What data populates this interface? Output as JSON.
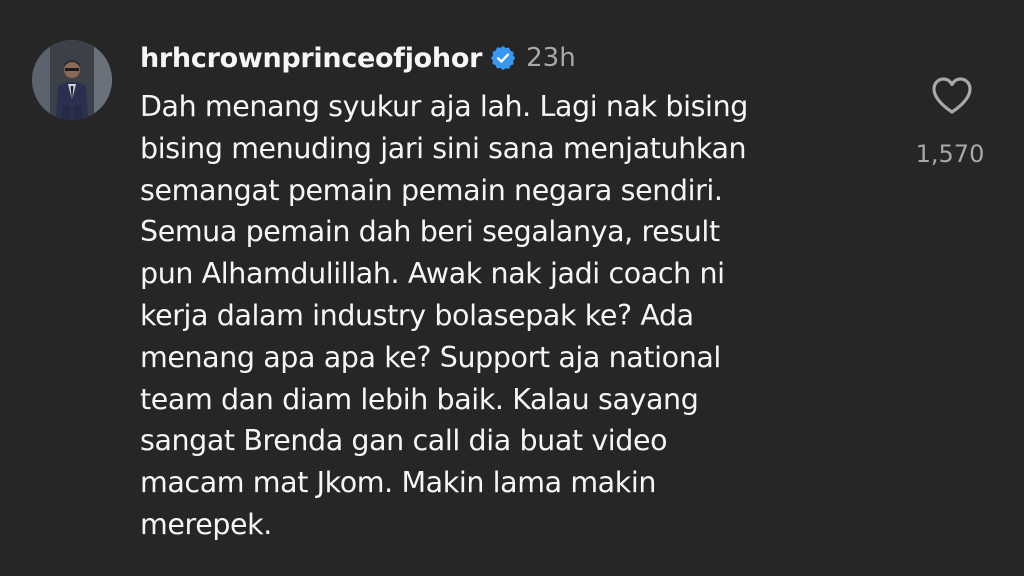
{
  "comment": {
    "username": "hrhcrownprinceofjohor",
    "verified_icon": "verified-badge-icon",
    "timestamp": "23h",
    "avatar_icon": "profile-avatar",
    "body_lines": [
      "Dah menang syukur aja lah. Lagi nak bising",
      "bising menuding jari sini sana menjatuhkan",
      "semangat pemain pemain negara sendiri.",
      "Semua pemain dah beri segalanya, result",
      "pun Alhamdulillah. Awak nak jadi coach ni",
      "kerja dalam industry bolasepak ke? Ada",
      "menang apa apa ke? Support aja national",
      "team dan diam lebih baik. Kalau sayang",
      "sangat Brenda gan call dia buat video",
      "macam mat Jkom. Makin lama makin",
      "merepek."
    ],
    "like_icon": "heart-icon",
    "like_count": "1,570"
  },
  "colors": {
    "background": "#262626",
    "text": "#f5f5f5",
    "secondary_text": "#a8a8a8",
    "verified_blue": "#3897f0"
  }
}
